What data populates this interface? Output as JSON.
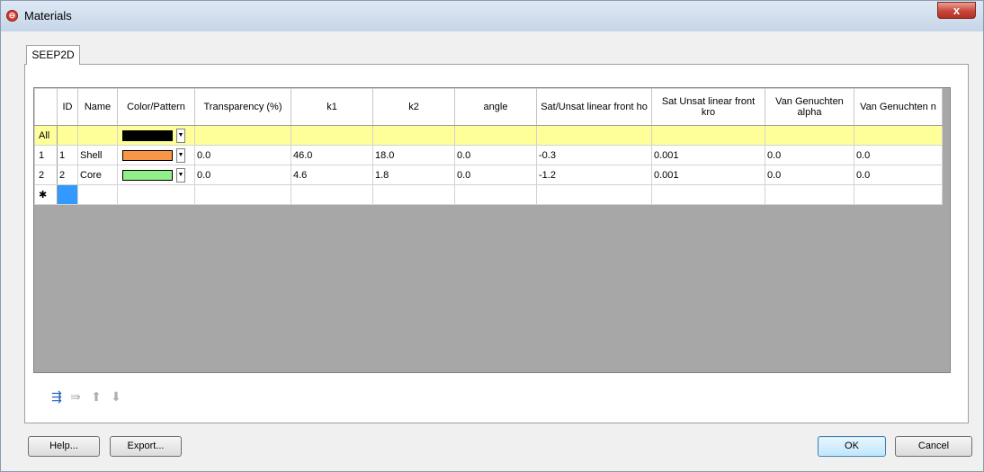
{
  "window": {
    "title": "Materials",
    "close_glyph": "x"
  },
  "tabs": [
    {
      "label": "SEEP2D"
    }
  ],
  "table": {
    "headers": [
      "",
      "ID",
      "Name",
      "Color/Pattern",
      "Transparency (%)",
      "k1",
      "k2",
      "angle",
      "Sat/Unsat linear front ho",
      "Sat Unsat linear front kro",
      "Van Genuchten alpha",
      "Van Genuchten n"
    ],
    "all_row": {
      "row_label": "All",
      "color": "#000000"
    },
    "rows": [
      {
        "row_label": "1",
        "id": "1",
        "name": "Shell",
        "color": "#f79646",
        "transparency": "0.0",
        "k1": "46.0",
        "k2": "18.0",
        "angle": "0.0",
        "ho": "-0.3",
        "kro": "0.001",
        "alpha": "0.0",
        "n": "0.0"
      },
      {
        "row_label": "2",
        "id": "2",
        "name": "Core",
        "color": "#92f08a",
        "transparency": "0.0",
        "k1": "4.6",
        "k2": "1.8",
        "angle": "0.0",
        "ho": "-1.2",
        "kro": "0.001",
        "alpha": "0.0",
        "n": "0.0"
      }
    ],
    "new_row": {
      "row_label": "✱"
    }
  },
  "toolbar": {
    "icons": [
      "insert-row-icon",
      "append-row-icon",
      "move-up-icon",
      "move-down-icon"
    ]
  },
  "buttons": {
    "help": "Help...",
    "export": "Export...",
    "ok": "OK",
    "cancel": "Cancel"
  }
}
